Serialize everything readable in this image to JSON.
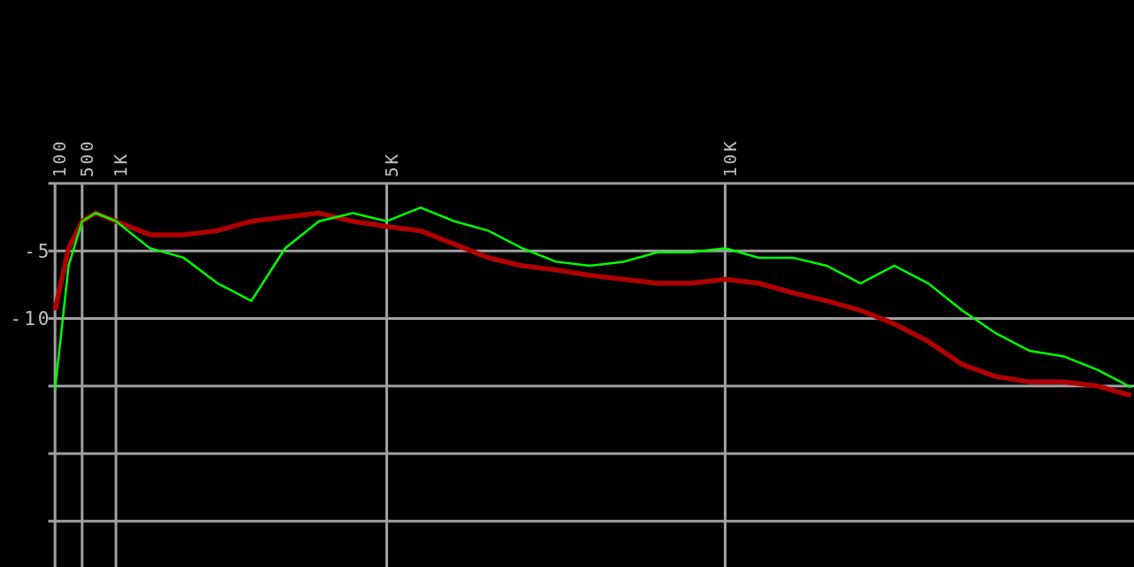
{
  "spectrum": {
    "chart_data": {
      "type": "line",
      "x": [
        100,
        300,
        500,
        700,
        1000,
        1500,
        2000,
        2500,
        3000,
        3500,
        4000,
        4500,
        5000,
        5500,
        6000,
        6500,
        7000,
        7500,
        8000,
        8500,
        9000,
        9500,
        10000,
        10500,
        11000,
        11500,
        12000,
        12500,
        13000,
        13500,
        14000,
        14500,
        15000,
        15500,
        16000
      ],
      "series": [
        {
          "color": "#b00000",
          "values": [
            -9.4,
            -4.8,
            -2.8,
            -2.2,
            -2.8,
            -3.8,
            -3.8,
            -3.5,
            -2.8,
            -2.5,
            -2.2,
            -2.8,
            -3.2,
            -3.5,
            -4.5,
            -5.5,
            -6.1,
            -6.4,
            -6.8,
            -7.1,
            -7.4,
            -7.4,
            -7.1,
            -7.4,
            -8.1,
            -8.7,
            -9.4,
            -10.4,
            -11.7,
            -13.4,
            -14.3,
            -14.7,
            -14.7,
            -15.0,
            -15.7
          ]
        },
        {
          "color": "#00ff00",
          "values": [
            -15.3,
            -6.1,
            -2.8,
            -2.2,
            -2.8,
            -4.8,
            -5.5,
            -7.4,
            -8.7,
            -4.8,
            -2.8,
            -2.2,
            -2.8,
            -1.8,
            -2.8,
            -3.5,
            -4.8,
            -5.8,
            -6.1,
            -5.8,
            -5.1,
            -5.1,
            -4.8,
            -5.5,
            -5.5,
            -6.1,
            -7.4,
            -6.1,
            -7.4,
            -9.4,
            -11.1,
            -12.4,
            -12.8,
            -13.8,
            -15.1
          ]
        }
      ],
      "xlim": [
        0,
        16040
      ],
      "ylim": [
        -28.4,
        0
      ],
      "grid": true,
      "xticks": [
        {
          "value": 100,
          "label": "100"
        },
        {
          "value": 500,
          "label": "500"
        },
        {
          "value": 1000,
          "label": "1K"
        },
        {
          "value": 5000,
          "label": "5K"
        },
        {
          "value": 10000,
          "label": "10K"
        }
      ],
      "yticks": [
        {
          "value": -5,
          "label": "-5"
        },
        {
          "value": -10,
          "label": "-10"
        }
      ]
    }
  }
}
